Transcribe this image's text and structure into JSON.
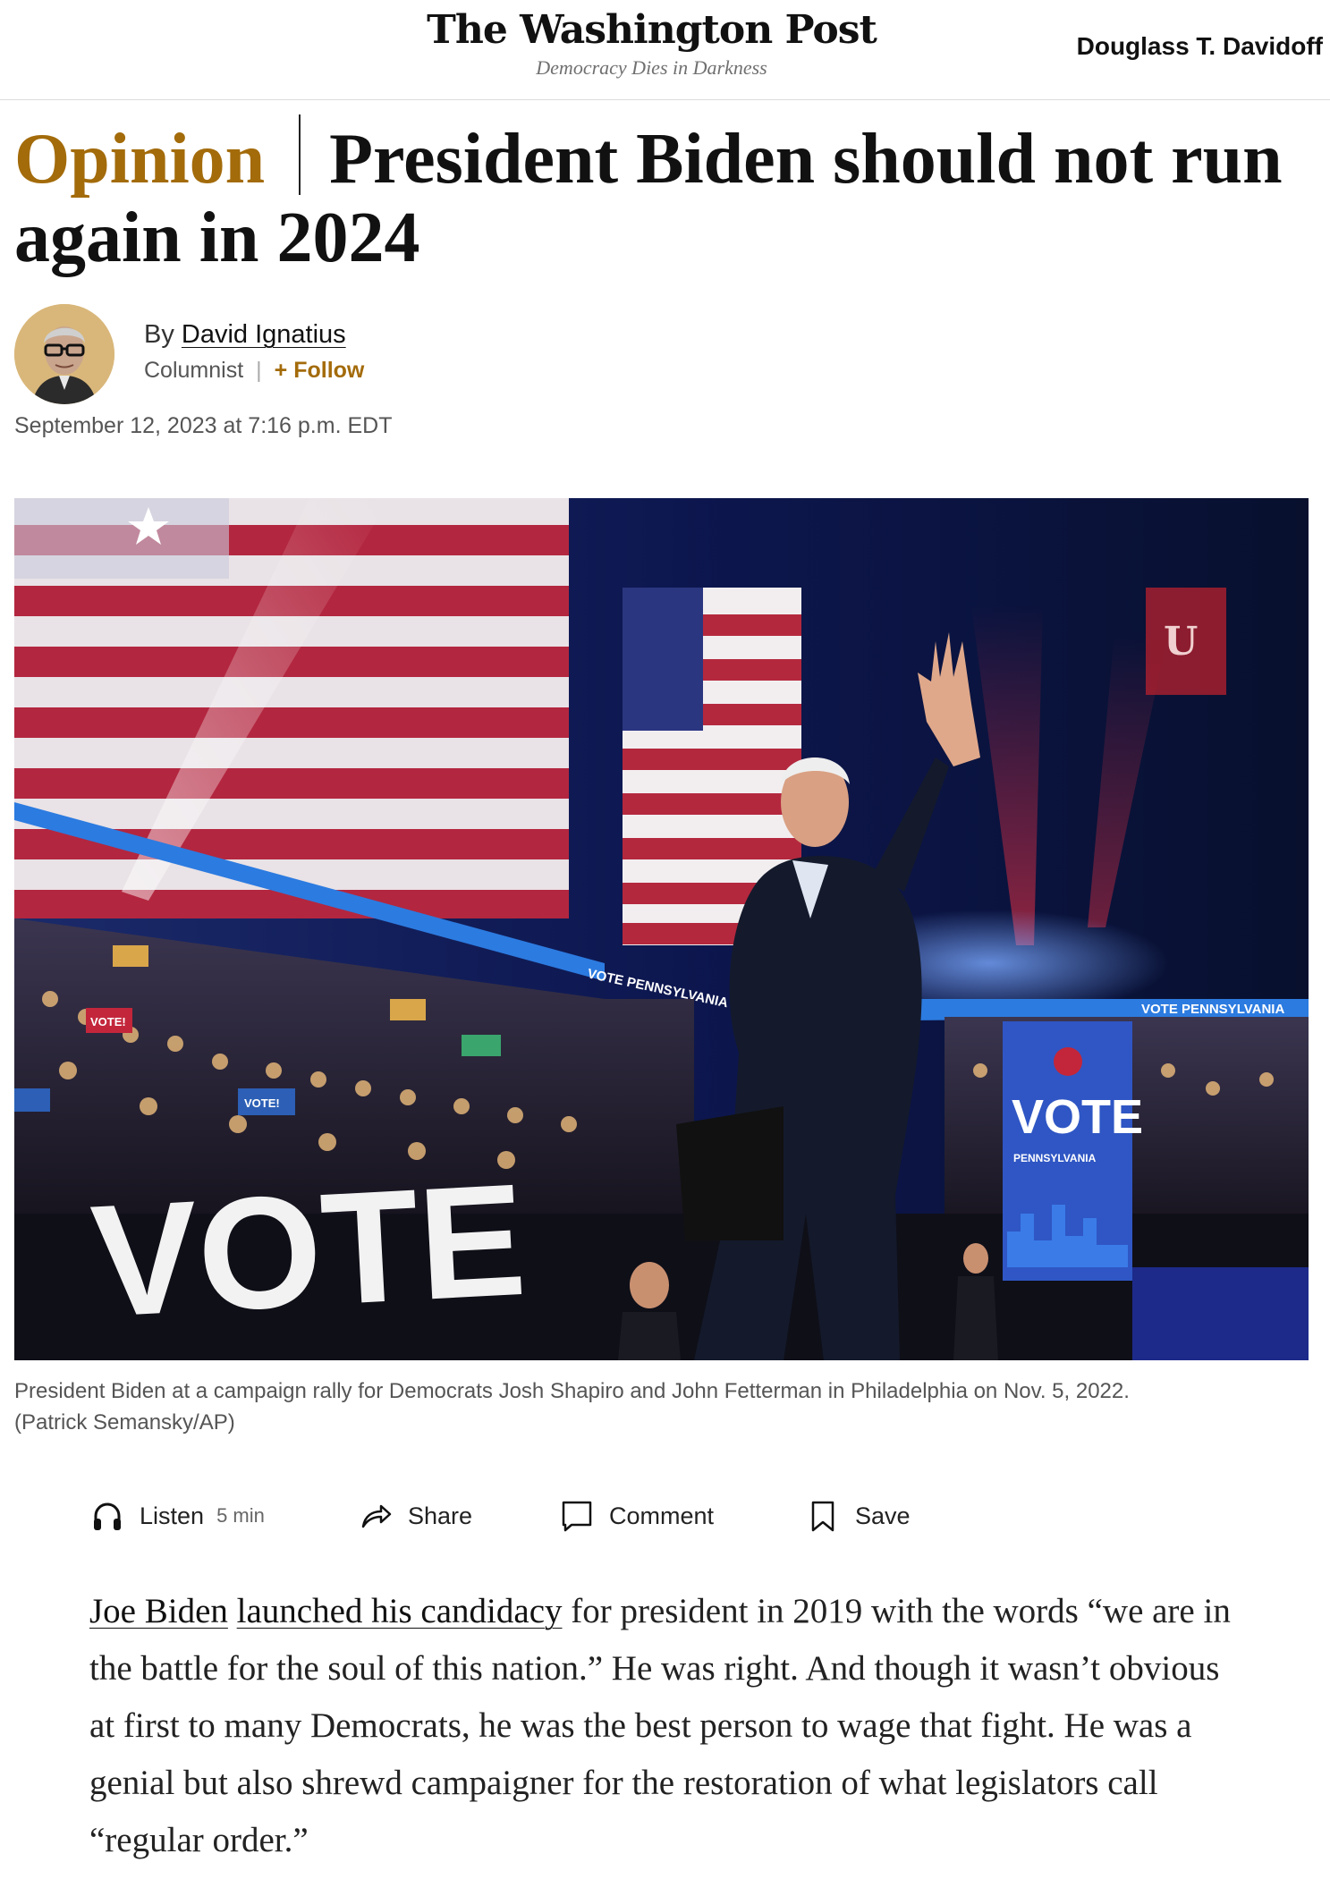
{
  "header": {
    "logo": "The Washington Post",
    "tagline": "Democracy Dies in Darkness",
    "user_name": "Douglass T. Davidoff"
  },
  "article": {
    "kicker": "Opinion",
    "headline": "President Biden should not run again in 2024",
    "byline_prefix": "By",
    "author": "David Ignatius",
    "author_role": "Columnist",
    "follow_label": "+ Follow",
    "date": "September 12, 2023 at 7:16 p.m. EDT",
    "image_signs": {
      "vote_big": "VOTE",
      "vote_banner": "VOTE",
      "banner_sub": "PENNSYLVANIA",
      "ribbon": "VOTE PENNSYLVANIA",
      "sign_small": "VOTE!"
    },
    "caption": "President Biden at a campaign rally for Democrats Josh Shapiro and John Fetterman in Philadelphia on Nov. 5, 2022.",
    "credit": "(Patrick Semansky/AP)"
  },
  "actions": {
    "listen_label": "Listen",
    "listen_duration": "5 min",
    "share_label": "Share",
    "comment_label": "Comment",
    "save_label": "Save"
  },
  "body": {
    "link1": "Joe Biden",
    "link2": "launched his candidacy",
    "text": " for president in 2019 with the words “we are in the battle for the soul of this nation.” He was right. And though it wasn’t obvious at first to many Democrats, he was the best person to wage that fight. He was a genial but also shrewd campaigner for the restoration of what legislators call “regular order.”"
  },
  "colors": {
    "opinion_accent": "#a36b0a",
    "link": "#111111"
  }
}
